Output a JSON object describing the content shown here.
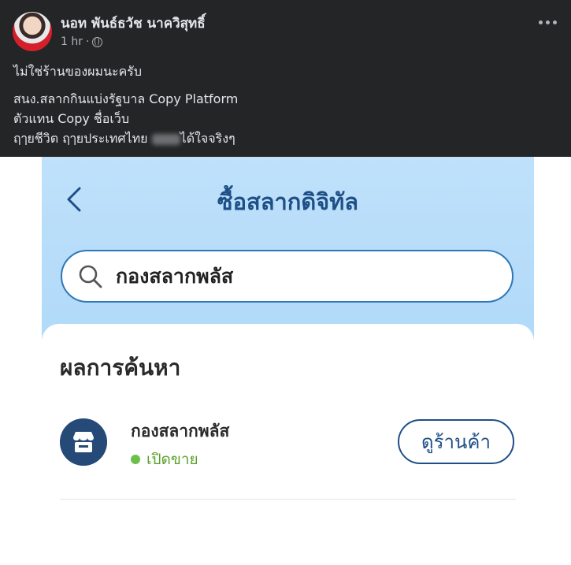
{
  "post": {
    "author": "นอท พันธ์ธวัช นาควิสุทธิ์",
    "time": "1 hr",
    "separator": "·",
    "text_line1": "ไม่ใช่ร้านของผมนะครับ",
    "text_line2": "สนง.สลากกินแบ่งรัฐบาล Copy Platform",
    "text_line3": "ตัวแทน Copy ชื่อเว็บ",
    "text_line4_start": "ฤๅยชีวิต ฤๅยประเทศไทย",
    "text_line4_end": "ได้ใจจริงๆ"
  },
  "app": {
    "title": "ซื้อสลากดิจิทัล",
    "search_value": "กองสลากพลัส",
    "results_heading": "ผลการค้นหา",
    "result": {
      "store_name": "กองสลากพลัส",
      "status": "เปิดขาย",
      "button_label": "ดูร้านค้า"
    }
  },
  "colors": {
    "post_bg": "#242526",
    "brand_blue": "#1e4f86",
    "status_green": "#5aa02c"
  },
  "icons": [
    "globe-icon",
    "more-options-icon",
    "back-arrow-icon",
    "search-icon",
    "store-icon"
  ]
}
